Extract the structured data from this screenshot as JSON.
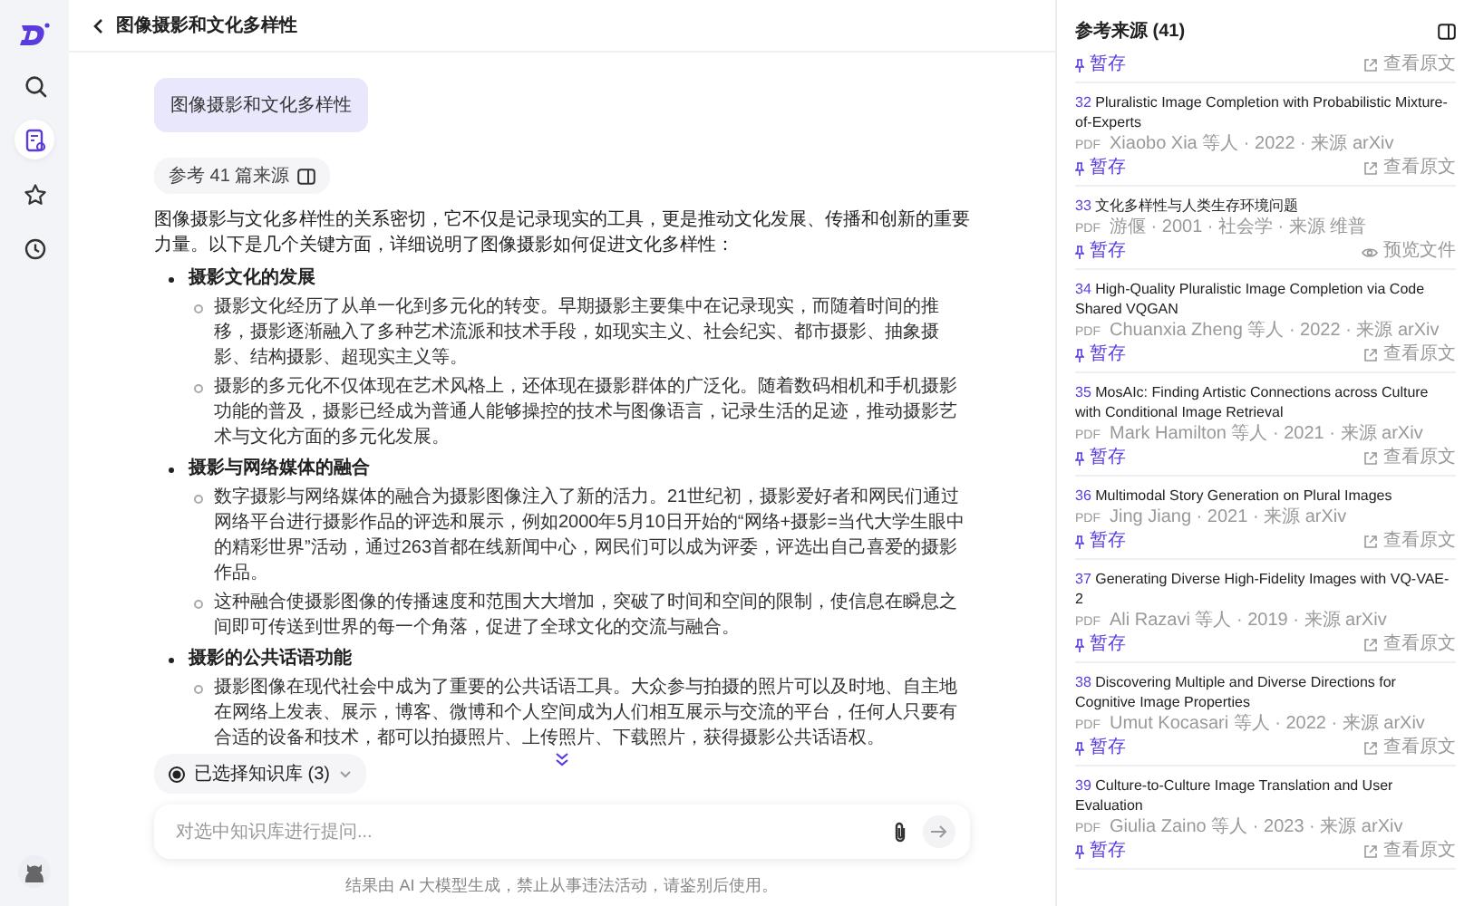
{
  "sidebar": {
    "items": [
      {
        "kind": "search",
        "selected": false
      },
      {
        "kind": "document",
        "selected": true
      },
      {
        "kind": "star",
        "selected": false
      },
      {
        "kind": "history",
        "selected": false
      }
    ]
  },
  "header": {
    "title": "图像摄影和文化多样性"
  },
  "chat": {
    "question": "图像摄影和文化多样性",
    "sources_chip": "参考 41 篇来源",
    "intro": "图像摄影与文化多样性的关系密切，它不仅是记录现实的工具，更是推动文化发展、传播和创新的重要力量。以下是几个关键方面，详细说明了图像摄影如何促进文化多样性：",
    "sections": [
      {
        "heading": "摄影文化的发展",
        "points": [
          "摄影文化经历了从单一化到多元化的转变。早期摄影主要集中在记录现实，而随着时间的推移，摄影逐渐融入了多种艺术流派和技术手段，如现实主义、社会纪实、都市摄影、抽象摄影、结构摄影、超现实主义等。",
          "摄影的多元化不仅体现在艺术风格上，还体现在摄影群体的广泛化。随着数码相机和手机摄影功能的普及，摄影已经成为普通人能够操控的技术与图像语言，记录生活的足迹，推动摄影艺术与文化方面的多元化发展。"
        ]
      },
      {
        "heading": "摄影与网络媒体的融合",
        "points": [
          "数字摄影与网络媒体的融合为摄影图像注入了新的活力。21世纪初，摄影爱好者和网民们通过网络平台进行摄影作品的评选和展示，例如2000年5月10日开始的“网络+摄影=当代大学生眼中的精彩世界”活动，通过263首都在线新闻中心，网民们可以成为评委，评选出自己喜爱的摄影作品。",
          "这种融合使摄影图像的传播速度和范围大大增加，突破了时间和空间的限制，使信息在瞬息之间即可传送到世界的每一个角落，促进了全球文化的交流与融合。"
        ]
      },
      {
        "heading": "摄影的公共话语功能",
        "points": [
          "摄影图像在现代社会中成为了重要的公共话语工具。大众参与拍摄的照片可以及时地、自主地在网络上发表、展示，博客、微博和个人空间成为人们相互展示与交流的平台，任何人只要有合适的设备和技术，都可以拍摄照片、上传照片、下载照片，获得摄影公共话语权。"
        ]
      }
    ],
    "knowledge_chip": "已选择知识库 (3)",
    "input": {
      "placeholder": "对选中知识库进行提问..."
    },
    "disclaimer": "结果由 AI 大模型生成，禁止从事违法活动，请鉴别后使用。"
  },
  "references": {
    "title": "参考来源 (41)",
    "partial": {
      "save": "暂存",
      "action": "查看原文",
      "kind": "link"
    },
    "items": [
      {
        "number": "32",
        "title": "Pluralistic Image Completion with Probabilistic Mixture-of-Experts",
        "type": "PDF",
        "meta": "Xiaobo Xia 等人 · 2022 · 来源 arXiv",
        "save": "暂存",
        "action": "查看原文",
        "kind": "link"
      },
      {
        "number": "33",
        "title": "文化多样性与人类生存环境问题",
        "type": "PDF",
        "meta": "游偃 · 2001 · 社会学 · 来源 维普",
        "save": "暂存",
        "action": "预览文件",
        "kind": "preview"
      },
      {
        "number": "34",
        "title": "High-Quality Pluralistic Image Completion via Code Shared VQGAN",
        "type": "PDF",
        "meta": "Chuanxia Zheng 等人 · 2022 · 来源 arXiv",
        "save": "暂存",
        "action": "查看原文",
        "kind": "link"
      },
      {
        "number": "35",
        "title": "MosAIc: Finding Artistic Connections across Culture with Conditional  Image Retrieval",
        "type": "PDF",
        "meta": "Mark Hamilton 等人 · 2021 · 来源 arXiv",
        "save": "暂存",
        "action": "查看原文",
        "kind": "link"
      },
      {
        "number": "36",
        "title": "Multimodal Story Generation on Plural Images",
        "type": "PDF",
        "meta": "Jing Jiang · 2021 · 来源 arXiv",
        "save": "暂存",
        "action": "查看原文",
        "kind": "link"
      },
      {
        "number": "37",
        "title": "Generating Diverse High-Fidelity Images with VQ-VAE-2",
        "type": "PDF",
        "meta": "Ali Razavi 等人 · 2019 · 来源 arXiv",
        "save": "暂存",
        "action": "查看原文",
        "kind": "link"
      },
      {
        "number": "38",
        "title": "Discovering Multiple and Diverse Directions for Cognitive Image  Properties",
        "type": "PDF",
        "meta": "Umut Kocasari 等人 · 2022 · 来源 arXiv",
        "save": "暂存",
        "action": "查看原文",
        "kind": "link"
      },
      {
        "number": "39",
        "title": "Culture-to-Culture Image Translation and User Evaluation",
        "type": "PDF",
        "meta": "Giulia Zaino 等人 · 2023 · 来源 arXiv",
        "save": "暂存",
        "action": "查看原文",
        "kind": "link"
      }
    ]
  }
}
